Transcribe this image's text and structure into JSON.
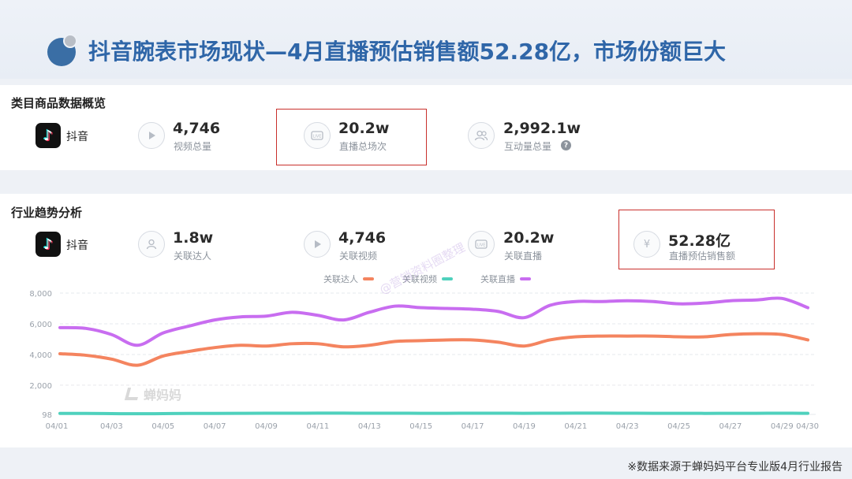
{
  "title": "抖音腕表市场现状—4月直播预估销售额52.28亿，市场份额巨大",
  "overview": {
    "section_title": "类目商品数据概览",
    "platform": "抖音",
    "stats": [
      {
        "value": "4,746",
        "label": "视频总量",
        "icon": "play-icon"
      },
      {
        "value": "20.2w",
        "label": "直播总场次",
        "icon": "live-icon"
      },
      {
        "value": "2,992.1w",
        "label": "互动量总量",
        "icon": "users-icon"
      }
    ]
  },
  "trend": {
    "section_title": "行业趋势分析",
    "platform": "抖音",
    "stats": [
      {
        "value": "1.8w",
        "label": "关联达人",
        "icon": "person-icon"
      },
      {
        "value": "4,746",
        "label": "关联视频",
        "icon": "play-icon"
      },
      {
        "value": "20.2w",
        "label": "关联直播",
        "icon": "live-icon"
      },
      {
        "value": "52.28亿",
        "label": "直播预估销售额",
        "icon": "yen-icon"
      }
    ]
  },
  "legend": [
    {
      "label": "关联达人",
      "color": "#f4845f"
    },
    {
      "label": "关联视频",
      "color": "#4fd1bd"
    },
    {
      "label": "关联直播",
      "color": "#c86df0"
    }
  ],
  "watermark_text": "@营销资料圈整理",
  "logo_watermark": "蝉妈妈",
  "footnote": "※数据来源于蝉妈妈平台专业版4月行业报告",
  "chart_data": {
    "type": "line",
    "x": [
      "04/01",
      "04/02",
      "04/03",
      "04/04",
      "04/05",
      "04/06",
      "04/07",
      "04/08",
      "04/09",
      "04/10",
      "04/11",
      "04/12",
      "04/13",
      "04/14",
      "04/15",
      "04/16",
      "04/17",
      "04/18",
      "04/19",
      "04/20",
      "04/21",
      "04/22",
      "04/23",
      "04/24",
      "04/25",
      "04/26",
      "04/27",
      "04/28",
      "04/29",
      "04/30"
    ],
    "x_tick_labels": [
      "04/01",
      "04/03",
      "04/05",
      "04/07",
      "04/09",
      "04/11",
      "04/13",
      "04/15",
      "04/17",
      "04/19",
      "04/21",
      "04/23",
      "04/25",
      "04/27",
      "04/29",
      "04/30"
    ],
    "y_tick_labels": [
      "98",
      "2,000",
      "4,000",
      "6,000",
      "8,000"
    ],
    "y_ticks": [
      98,
      2000,
      4000,
      6000,
      8000
    ],
    "ylim": [
      98,
      8000
    ],
    "grid": true,
    "series": [
      {
        "name": "关联达人",
        "color": "#f4845f",
        "values": [
          4050,
          3950,
          3700,
          3300,
          3900,
          4200,
          4450,
          4600,
          4550,
          4700,
          4700,
          4500,
          4600,
          4850,
          4900,
          4950,
          4950,
          4800,
          4550,
          4950,
          5150,
          5200,
          5200,
          5200,
          5150,
          5150,
          5300,
          5350,
          5300,
          4950
        ]
      },
      {
        "name": "关联视频",
        "color": "#4fd1bd",
        "values": [
          160,
          160,
          150,
          140,
          150,
          160,
          165,
          170,
          175,
          175,
          180,
          180,
          175,
          175,
          170,
          170,
          175,
          175,
          170,
          175,
          180,
          180,
          175,
          170,
          170,
          165,
          170,
          170,
          175,
          170
        ]
      },
      {
        "name": "关联直播",
        "color": "#c86df0",
        "values": [
          5750,
          5700,
          5300,
          4600,
          5400,
          5850,
          6250,
          6450,
          6500,
          6750,
          6550,
          6250,
          6750,
          7150,
          7050,
          7000,
          6950,
          6800,
          6400,
          7200,
          7450,
          7450,
          7500,
          7450,
          7300,
          7350,
          7500,
          7550,
          7650,
          7050
        ]
      }
    ]
  }
}
